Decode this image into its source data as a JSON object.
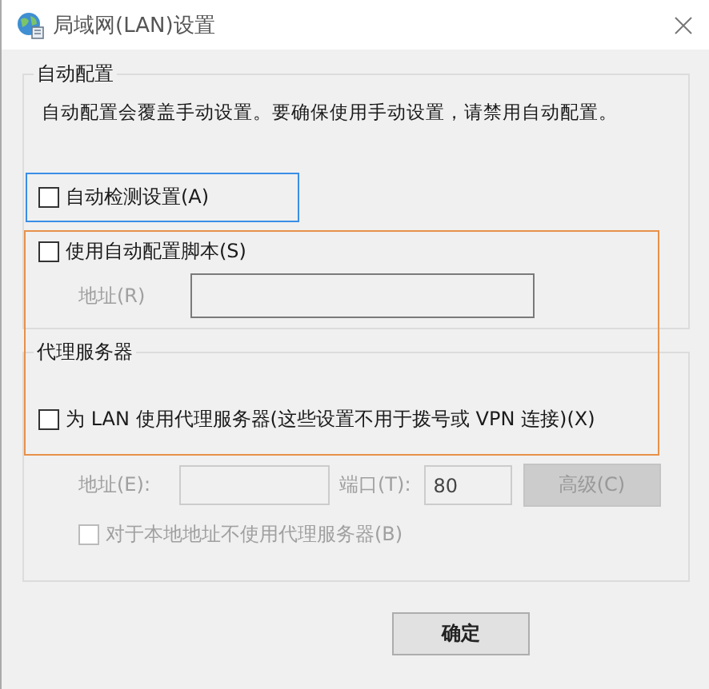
{
  "window": {
    "title": "局域网(LAN)设置"
  },
  "auto_config": {
    "title": "自动配置",
    "description": "自动配置会覆盖手动设置。要确保使用手动设置，请禁用自动配置。",
    "auto_detect": {
      "label": "自动检测设置(A)",
      "checked": false
    },
    "script": {
      "label": "使用自动配置脚本(S)",
      "checked": false
    },
    "script_address": {
      "label": "地址(R)",
      "disabled": true
    }
  },
  "proxy": {
    "title": "代理服务器",
    "use_proxy": {
      "label": "为 LAN 使用代理服务器(这些设置不用于拨号或 VPN 连接)(X)",
      "checked": false
    },
    "address": {
      "label": "地址(E):",
      "disabled": true
    },
    "port": {
      "label": "端口(T):",
      "value": "80",
      "disabled": true
    },
    "advanced_button": {
      "label": "高级(C)",
      "disabled": true
    },
    "bypass_local": {
      "label": "对于本地地址不使用代理服务器(B)",
      "checked": false,
      "disabled": true
    }
  },
  "buttons": [
    {
      "label": "确定"
    }
  ],
  "annotations": [
    {
      "color": "#3a8ee6"
    },
    {
      "color": "#e8914a"
    }
  ]
}
